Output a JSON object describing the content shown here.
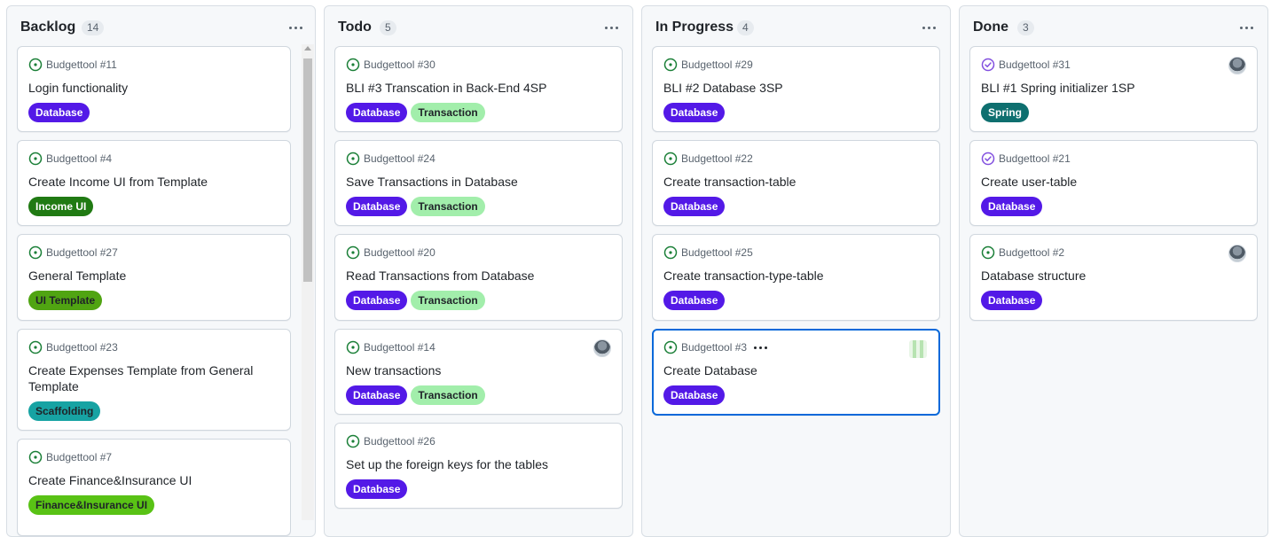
{
  "colors": {
    "accent": "#0969da",
    "open_icon": "#1a7f37",
    "closed_icon": "#8250df",
    "label_database": "#5319e7",
    "label_transaction": "#a2eeab",
    "label_income_ui": "#207a13",
    "label_ui_template": "#50a412",
    "label_scaffolding": "#17a3a3",
    "label_finance": "#59c215",
    "label_spring": "#0e6f6f"
  },
  "columns": [
    {
      "title": "Backlog",
      "count": "14",
      "cards": [
        {
          "ref": "Budgettool #11",
          "title": "Login functionality",
          "labels": [
            "Database"
          ]
        },
        {
          "ref": "Budgettool #4",
          "title": "Create Income UI from Template",
          "labels": [
            "Income UI"
          ]
        },
        {
          "ref": "Budgettool #27",
          "title": "General Template",
          "labels": [
            "UI Template"
          ]
        },
        {
          "ref": "Budgettool #23",
          "title": "Create Expenses Template from General Template",
          "labels": [
            "Scaffolding"
          ]
        },
        {
          "ref": "Budgettool #7",
          "title": "Create Finance&Insurance UI",
          "labels": [
            "Finance&Insurance UI"
          ]
        }
      ]
    },
    {
      "title": "Todo",
      "count": "5",
      "cards": [
        {
          "ref": "Budgettool #30",
          "title": "BLI #3 Transcation in Back-End 4SP",
          "labels": [
            "Database",
            "Transaction"
          ]
        },
        {
          "ref": "Budgettool #24",
          "title": "Save Transactions in Database",
          "labels": [
            "Database",
            "Transaction"
          ]
        },
        {
          "ref": "Budgettool #20",
          "title": "Read Transactions from Database",
          "labels": [
            "Database",
            "Transaction"
          ]
        },
        {
          "ref": "Budgettool #14",
          "title": "New transactions",
          "labels": [
            "Database",
            "Transaction"
          ]
        },
        {
          "ref": "Budgettool #26",
          "title": "Set up the foreign keys for the tables",
          "labels": [
            "Database"
          ]
        }
      ]
    },
    {
      "title": "In Progress",
      "count": "4",
      "cards": [
        {
          "ref": "Budgettool #29",
          "title": "BLI #2 Database 3SP",
          "labels": [
            "Database"
          ]
        },
        {
          "ref": "Budgettool #22",
          "title": "Create transaction-table",
          "labels": [
            "Database"
          ]
        },
        {
          "ref": "Budgettool #25",
          "title": "Create transaction-type-table",
          "labels": [
            "Database"
          ]
        },
        {
          "ref": "Budgettool #3",
          "title": "Create Database",
          "labels": [
            "Database"
          ]
        }
      ]
    },
    {
      "title": "Done",
      "count": "3",
      "cards": [
        {
          "ref": "Budgettool #31",
          "title": "BLI #1 Spring initializer 1SP",
          "labels": [
            "Spring"
          ]
        },
        {
          "ref": "Budgettool #21",
          "title": "Create user-table",
          "labels": [
            "Database"
          ]
        },
        {
          "ref": "Budgettool #2",
          "title": "Database structure",
          "labels": [
            "Database"
          ]
        }
      ]
    }
  ]
}
